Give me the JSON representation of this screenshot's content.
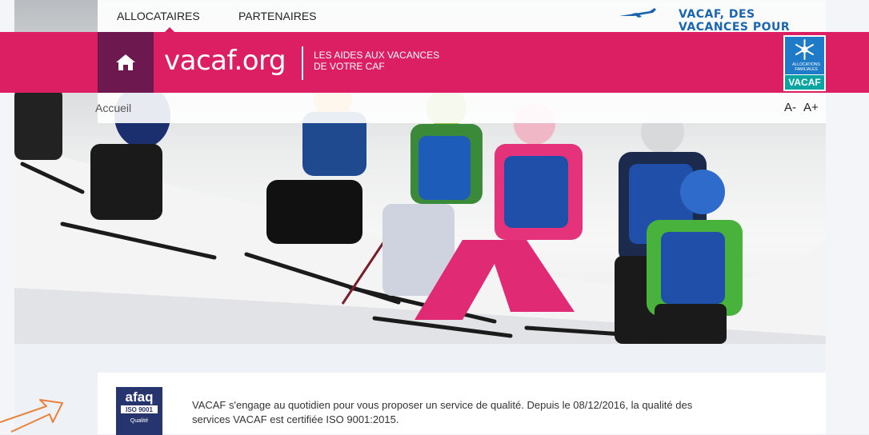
{
  "nav": {
    "links": [
      "ALLOCATAIRES",
      "PARTENAIRES"
    ],
    "slogan": "VACAF, DES VACANCES POUR TOUS"
  },
  "header": {
    "title": "vacaf.org",
    "tagline_line1": "LES AIDES AUX VACANCES",
    "tagline_line2": "DE VOTRE CAF",
    "logo_caption": "ALLOCATIONS FAMILIALES",
    "logo_label": "VACAF"
  },
  "breadcrumb": {
    "home": "Accueil"
  },
  "font_controls": {
    "decrease": "A-",
    "increase": "A+"
  },
  "quality": {
    "badge_brand": "afaq",
    "badge_cert": "ISO 9001",
    "badge_sub": "Qualité",
    "text_line1": "VACAF s'engage au quotidien pour vous proposer un service de qualité. Depuis le 08/12/2016, la qualité des",
    "text_line2": "services VACAF est certifiée ISO 9001:2015."
  },
  "colors": {
    "brand_pink": "#dc1f62",
    "home_purple": "#6e1850",
    "slogan_blue": "#1b65b0",
    "arrow_orange": "#e8823a"
  }
}
